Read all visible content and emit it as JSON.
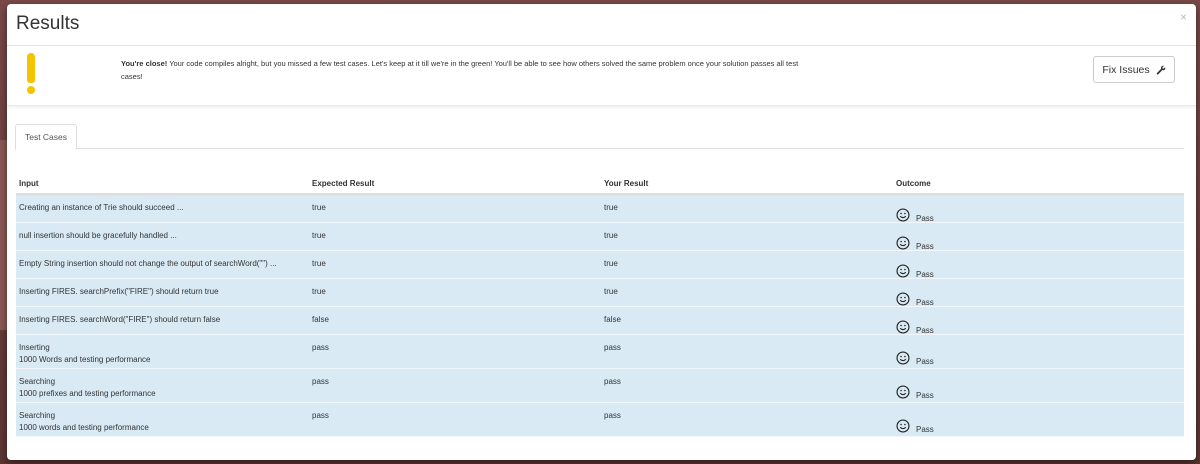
{
  "modal": {
    "title": "Results",
    "close": "×"
  },
  "alert": {
    "strong": "You're close!",
    "message": " Your code compiles alright, but you missed a few test cases. Let's keep at it till we're in the green! You'll be able to see how others solved the same problem once your solution passes all test cases!",
    "icon": "exclamation-icon",
    "icon_color": "#f5c400"
  },
  "fix_button": {
    "label": "Fix Issues",
    "icon": "wrench-icon"
  },
  "tabs": [
    {
      "label": "Test Cases"
    }
  ],
  "table": {
    "headers": [
      "Input",
      "Expected Result",
      "Your Result",
      "Outcome"
    ],
    "row_color": "#d9eaf5",
    "rows": [
      {
        "input": [
          "Creating an instance of Trie should succeed ..."
        ],
        "expected": "true",
        "result": "true",
        "outcome": "Pass"
      },
      {
        "input": [
          "null insertion should be gracefully handled ..."
        ],
        "expected": "true",
        "result": "true",
        "outcome": "Pass"
      },
      {
        "input": [
          "Empty String insertion should not change the output of searchWord(\"\") ..."
        ],
        "expected": "true",
        "result": "true",
        "outcome": "Pass"
      },
      {
        "input": [
          "Inserting FIRES. searchPrefix(\"FIRE\") should return true"
        ],
        "expected": "true",
        "result": "true",
        "outcome": "Pass"
      },
      {
        "input": [
          "Inserting FIRES. searchWord(\"FIRE\") should return false"
        ],
        "expected": "false",
        "result": "false",
        "outcome": "Pass"
      },
      {
        "input": [
          "Inserting",
          "1000 Words and testing performance"
        ],
        "expected": "pass",
        "result": "pass",
        "outcome": "Pass"
      },
      {
        "input": [
          "Searching",
          "1000 prefixes and testing performance"
        ],
        "expected": "pass",
        "result": "pass",
        "outcome": "Pass"
      },
      {
        "input": [
          "Searching",
          "1000 words and testing performance"
        ],
        "expected": "pass",
        "result": "pass",
        "outcome": "Pass"
      }
    ]
  }
}
